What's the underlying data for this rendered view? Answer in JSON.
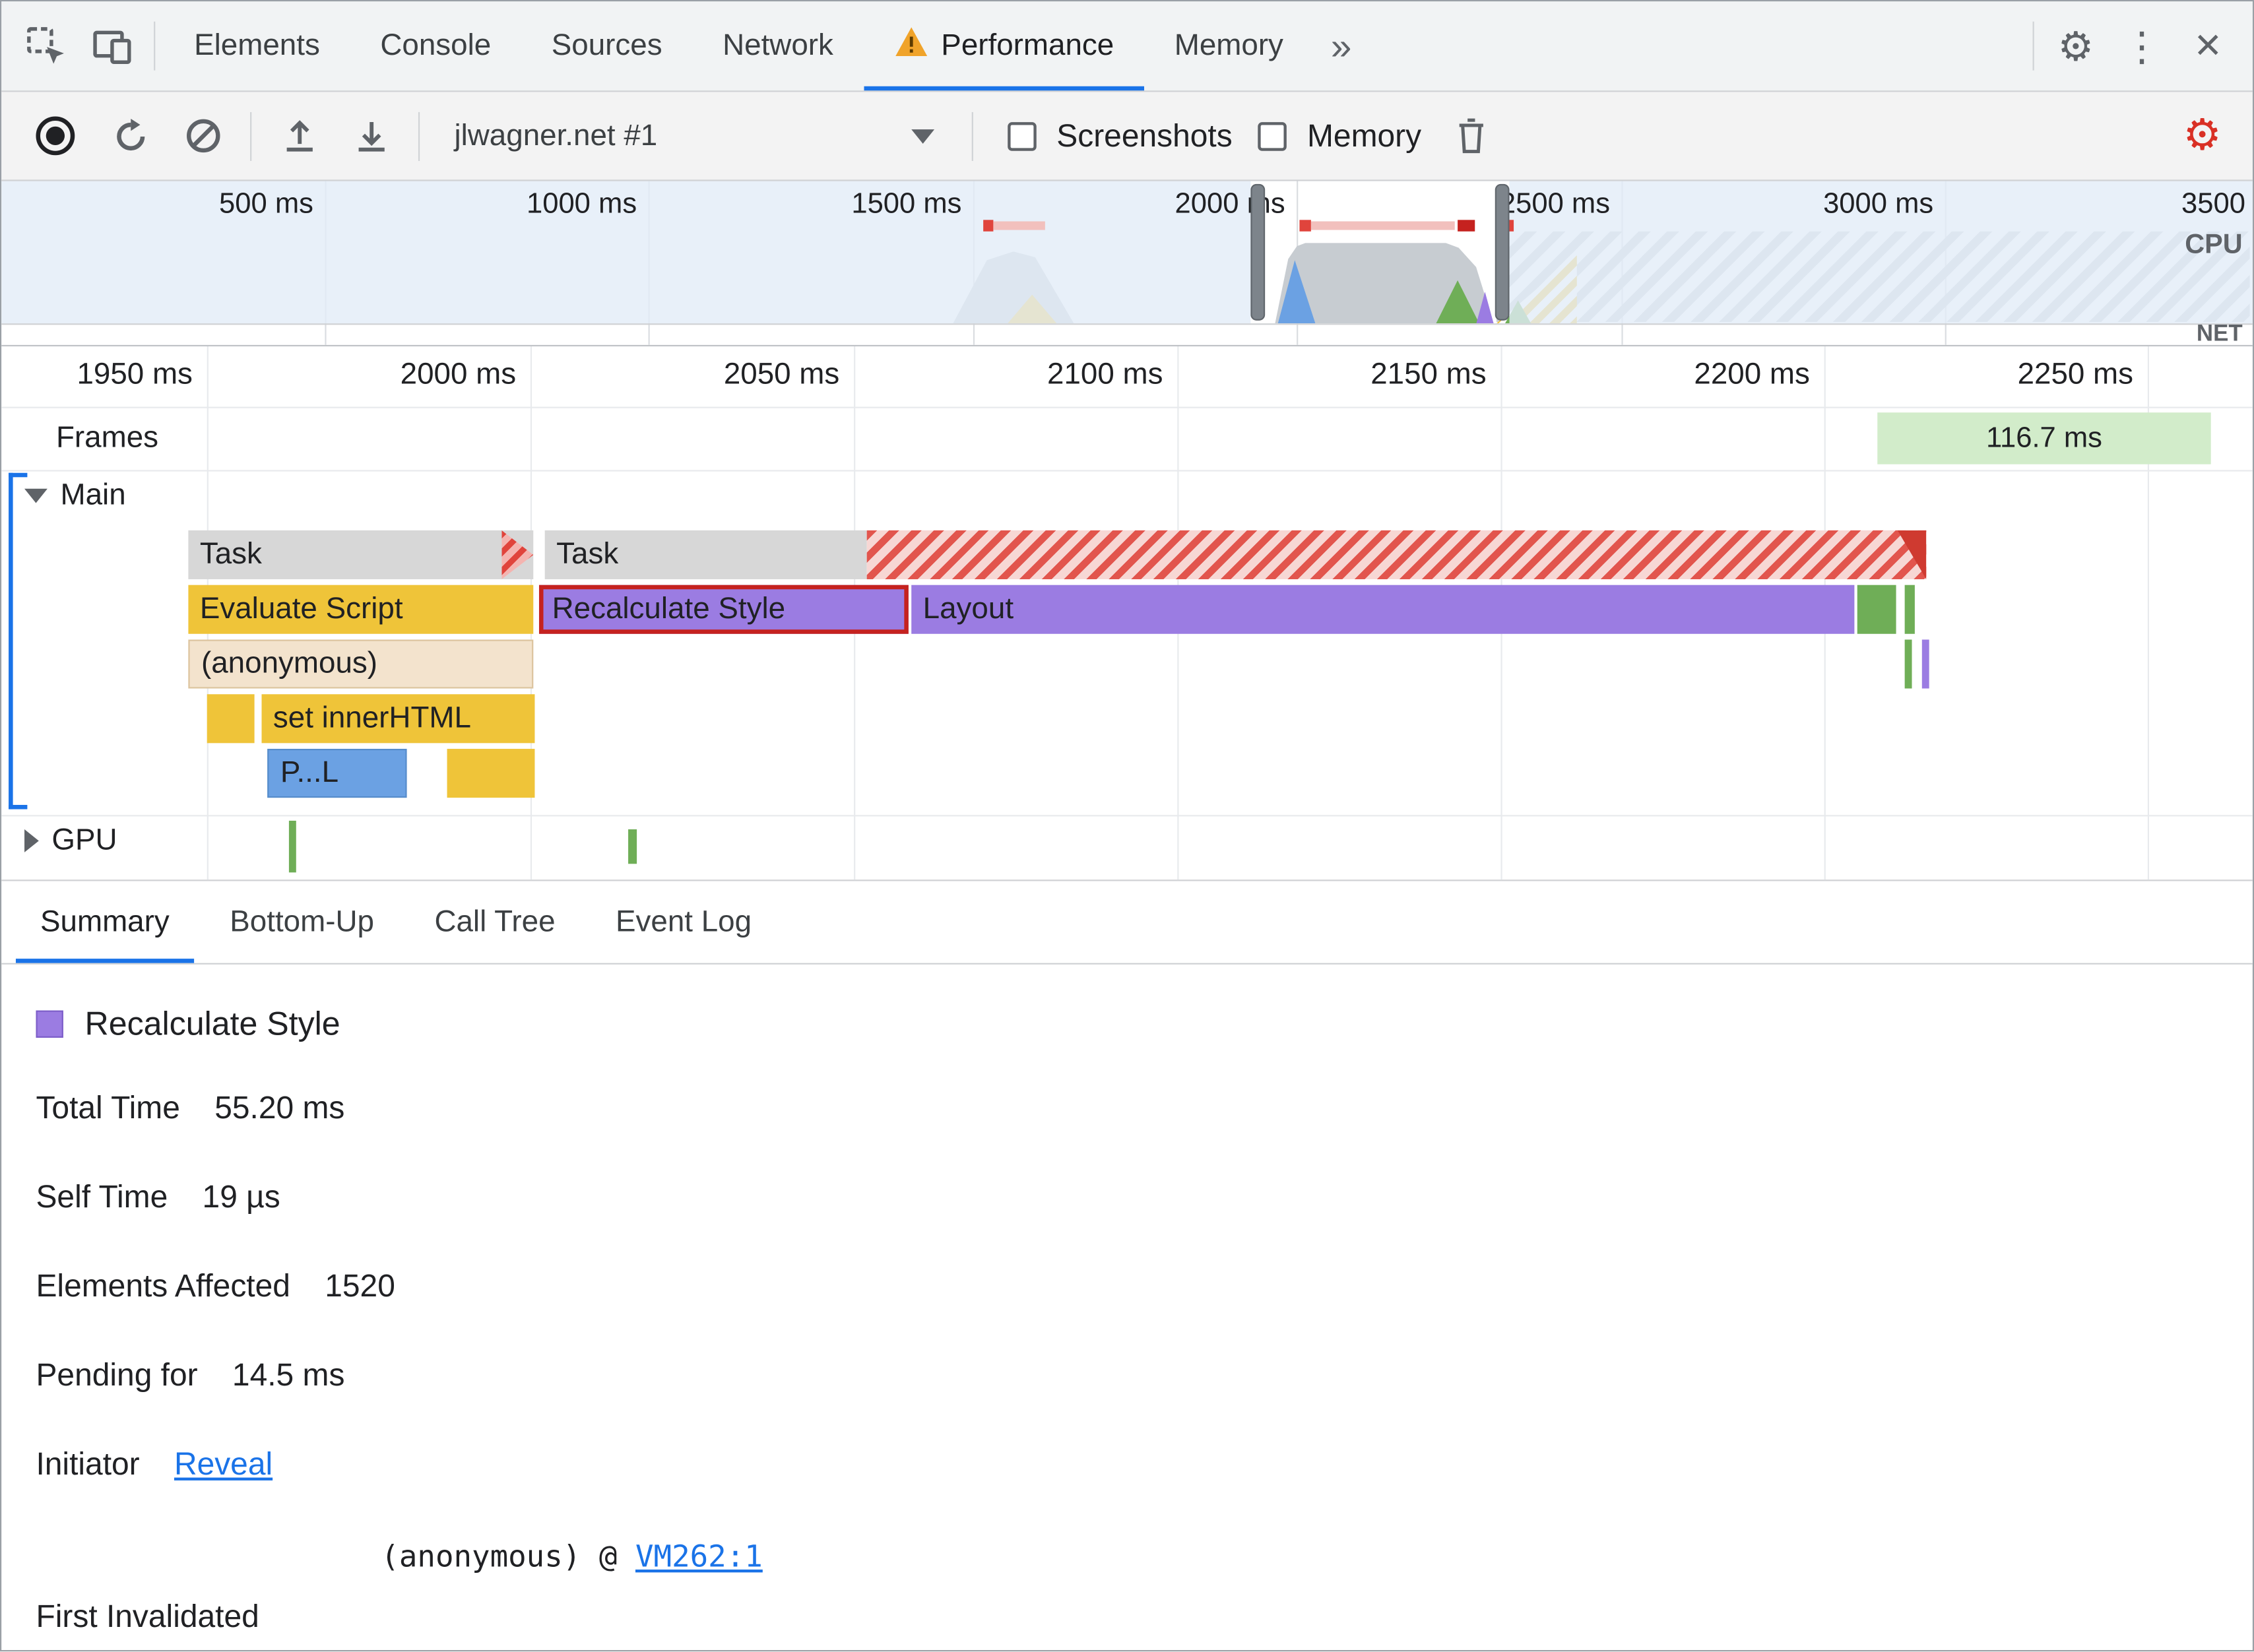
{
  "icons": {
    "gear": "⚙",
    "kebab": "⋮",
    "close": "✕",
    "more": "»"
  },
  "top_bar": {
    "tabs": [
      {
        "label": "Elements"
      },
      {
        "label": "Console"
      },
      {
        "label": "Sources"
      },
      {
        "label": "Network"
      },
      {
        "label": "Performance"
      },
      {
        "label": "Memory"
      }
    ]
  },
  "toolbar": {
    "profile_name": "jlwagner.net #1",
    "screenshots_label": "Screenshots",
    "memory_label": "Memory"
  },
  "overview": {
    "ticks": [
      "500 ms",
      "1000 ms",
      "1500 ms",
      "2000 ms",
      "2500 ms",
      "3000 ms",
      "3500"
    ],
    "cpu_label": "CPU",
    "net_label": "NET"
  },
  "timeline": {
    "ticks": [
      "1950 ms",
      "2000 ms",
      "2050 ms",
      "2100 ms",
      "2150 ms",
      "2200 ms",
      "2250 ms"
    ],
    "frames_label": "Frames",
    "frame_duration": "116.7 ms",
    "main_track_label": "Main",
    "gpu_track_label": "GPU",
    "bars": {
      "task1": "Task",
      "task2": "Task",
      "evaluate_script": "Evaluate Script",
      "recalculate_style": "Recalculate Style",
      "layout": "Layout",
      "anonymous": "(anonymous)",
      "set_inner_html": "set innerHTML",
      "parse_html": "P...L"
    }
  },
  "bottom_tabs": [
    {
      "label": "Summary"
    },
    {
      "label": "Bottom-Up"
    },
    {
      "label": "Call Tree"
    },
    {
      "label": "Event Log"
    }
  ],
  "summary": {
    "selected_event": "Recalculate Style",
    "stats": [
      {
        "label": "Total Time",
        "value": "55.20 ms"
      },
      {
        "label": "Self Time",
        "value": "19 µs"
      },
      {
        "label": "Elements Affected",
        "value": "1520"
      },
      {
        "label": "Pending for",
        "value": "14.5 ms"
      }
    ],
    "initiator": {
      "label": "Initiator",
      "link": "Reveal"
    },
    "first_invalidated": {
      "label": "First Invalidated",
      "value_prefix": "(anonymous) @ ",
      "link": "VM262:1"
    }
  }
}
